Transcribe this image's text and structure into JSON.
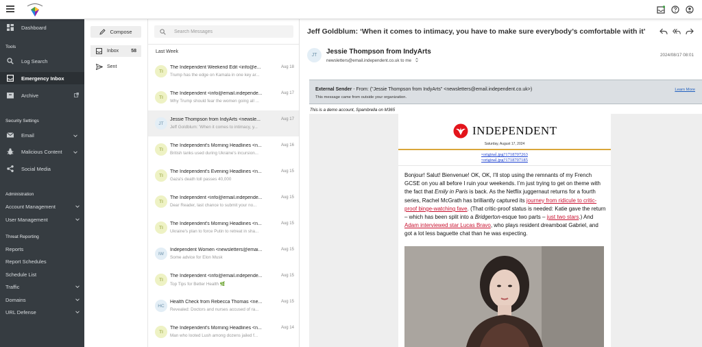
{
  "sidebar": {
    "dashboard": "Dashboard",
    "tools_heading": "Tools",
    "log_search": "Log Search",
    "emergency_inbox": "Emergency Inbox",
    "archive": "Archive",
    "security_heading": "Security Settings",
    "email": "Email",
    "malicious_content": "Malicious Content",
    "social_media": "Social Media",
    "admin_heading": "Administration",
    "account_management": "Account Management",
    "user_management": "User Management",
    "threat_heading": "Threat Reporting",
    "reports": "Reports",
    "report_schedules": "Report Schedules",
    "schedule_list": "Schedule List",
    "traffic": "Traffic",
    "domains": "Domains",
    "url_defense": "URL Defense"
  },
  "folders": {
    "compose": "Compose",
    "inbox": "Inbox",
    "inbox_count": "58",
    "sent": "Sent"
  },
  "search": {
    "placeholder": "Search Messages"
  },
  "list": {
    "group": "Last Week",
    "messages": [
      {
        "initials": "TI",
        "from": "The Independent Weekend Edit <info@e...",
        "snippet": "Trump has the edge on Kamala in one key ar...",
        "date": "Aug 18"
      },
      {
        "initials": "TI",
        "from": "The Independent <info@email.independe...",
        "snippet": "Why Trump should fear the women going all ...",
        "date": "Aug 17"
      },
      {
        "initials": "JT",
        "from": "Jessie Thompson from IndyArts <newsle...",
        "snippet": "Jeff Goldblum: 'When it comes to intimacy, y...",
        "date": "Aug 17"
      },
      {
        "initials": "TI",
        "from": "The Independent's Morning Headlines <n...",
        "snippet": "British tanks used during Ukraine's incursion...",
        "date": "Aug 16"
      },
      {
        "initials": "TI",
        "from": "The Independent's Evening Headlines <n...",
        "snippet": "Gaza's death toll passes 40,000",
        "date": "Aug 15"
      },
      {
        "initials": "TI",
        "from": "The Independent <info@email.independe...",
        "snippet": "Dear Reader, last chance to submit your no...",
        "date": "Aug 15"
      },
      {
        "initials": "TI",
        "from": "The Independent's Morning Headlines <n...",
        "snippet": "Ukraine's plan to force Putin to retreat in sha...",
        "date": "Aug 15"
      },
      {
        "initials": "IW",
        "from": "Independent Women <newsletters@emai...",
        "snippet": "Some advice for Elon Musk",
        "date": "Aug 15"
      },
      {
        "initials": "TI",
        "from": "The Independent <info@email.independe...",
        "snippet": "Top Tips for Better Health 🌿",
        "date": "Aug 15"
      },
      {
        "initials": "HC",
        "from": "Health Check from Rebecca Thomas <ne...",
        "snippet": "Revealed: Doctors and nurses accused of ra...",
        "date": "Aug 15"
      },
      {
        "initials": "TI",
        "from": "The Independent's Morning Headlines <n...",
        "snippet": "Man who looted Lush among dozens jailed f...",
        "date": "Aug 14"
      }
    ]
  },
  "reader": {
    "subject": "Jeff Goldblum: ‘When it comes to intimacy, you have to make sure everybody’s comfortable with it’",
    "avatar": "JT",
    "sender_name": "Jessie Thompson from IndyArts",
    "sender_to": "newsletters@email.independent.co.uk to me",
    "date": "2024/08/17 08:01",
    "banner_bold": "External Sender",
    "banner_text": " - From: (\"Jessie Thompson from IndyArts\" <newsletters@email.independent.co.uk>)",
    "banner_sub": "This message came from outside your organization.",
    "learn_more": "Learn More",
    "demo_note": "This is a demo account, Spambrella on M365",
    "news_logo": "INDEPENDENT",
    "news_date": "Saturday, August 17, 2024",
    "img1": "original.jpg?17187072​63",
    "img2": "original.jpg?1718707185",
    "p_1": "Bonjour! Salut! Bienvenue! OK, OK, I’ll stop using the remnants of my French GCSE on you all before I ruin your weekends. I’m just trying to get on theme with the fact that ",
    "p_em1": "Emily in Paris",
    "p_2": " is back. As the Netflix juggernaut returns for a fourth series, Rachel McGrath has brilliantly captured its ",
    "p_link1": "journey from ridicule to critic-proof binge-watching fave",
    "p_3": ". (That critic-proof status is needed: Katie gave the return – which has been split into a ",
    "p_em2": "Bridgerton",
    "p_4": "-esque two parts – ",
    "p_link2": "just two stars",
    "p_5": ".) And ",
    "p_link3": "Adam interviewed star Lucas Bravo",
    "p_6": ", who plays resident dreamboat Gabriel, and got a lot less baguette chat than he was expecting."
  },
  "colors": {
    "sidebar_bg": "#363c41",
    "avatar_ti": "#eef2c4",
    "avatar_jt": "#e3eef6",
    "link_red": "#c8102e"
  }
}
